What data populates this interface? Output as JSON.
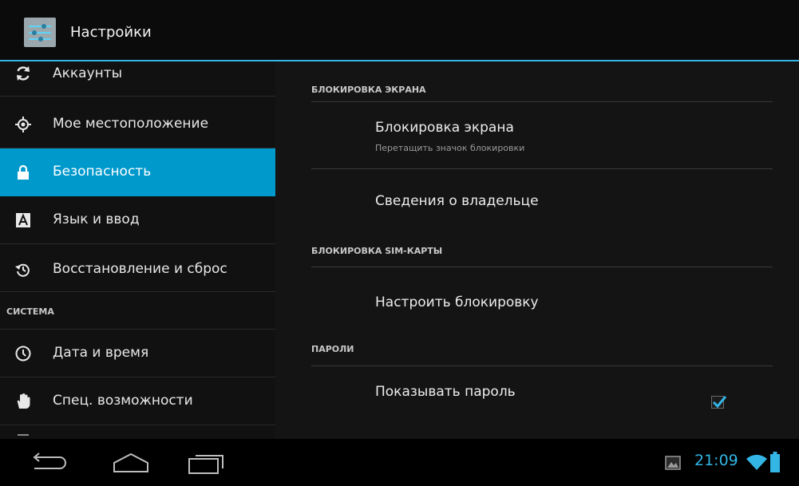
{
  "actionbar": {
    "title": "Настройки",
    "icon": "settings-icon"
  },
  "left_pane": {
    "items": [
      {
        "label": "Аккаунты",
        "icon": "sync-icon"
      },
      {
        "label": "Мое местоположение",
        "icon": "location-icon"
      },
      {
        "label": "Безопасность",
        "icon": "lock-icon",
        "active": true
      },
      {
        "label": "Язык и ввод",
        "icon": "keyboard-a-icon"
      },
      {
        "label": "Восстановление и сброс",
        "icon": "restore-icon"
      }
    ],
    "section_system": "СИСТЕМА",
    "system_items": [
      {
        "label": "Дата и время",
        "icon": "clock-icon"
      },
      {
        "label": "Спец. возможности",
        "icon": "hand-icon"
      }
    ]
  },
  "right_pane": {
    "sections": [
      {
        "header": "БЛОКИРОВКА ЭКРАНА",
        "items": [
          {
            "title": "Блокировка экрана",
            "summary": "Перетащить значок блокировки"
          },
          {
            "title": "Сведения о владельце"
          }
        ]
      },
      {
        "header": "БЛОКИРОВКА SIM-КАРТЫ",
        "items": [
          {
            "title": "Настроить блокировку"
          }
        ]
      },
      {
        "header": "ПАРОЛИ",
        "items": [
          {
            "title": "Показывать пароль",
            "checked": true
          }
        ]
      }
    ]
  },
  "system_bar": {
    "clock": "21:09",
    "icons": [
      "back-icon",
      "home-icon",
      "recent-apps-icon",
      "gallery-notification-icon",
      "wifi-icon",
      "battery-icon"
    ]
  },
  "colors": {
    "accent": "#33b5e5",
    "active_item": "#0099cc"
  }
}
